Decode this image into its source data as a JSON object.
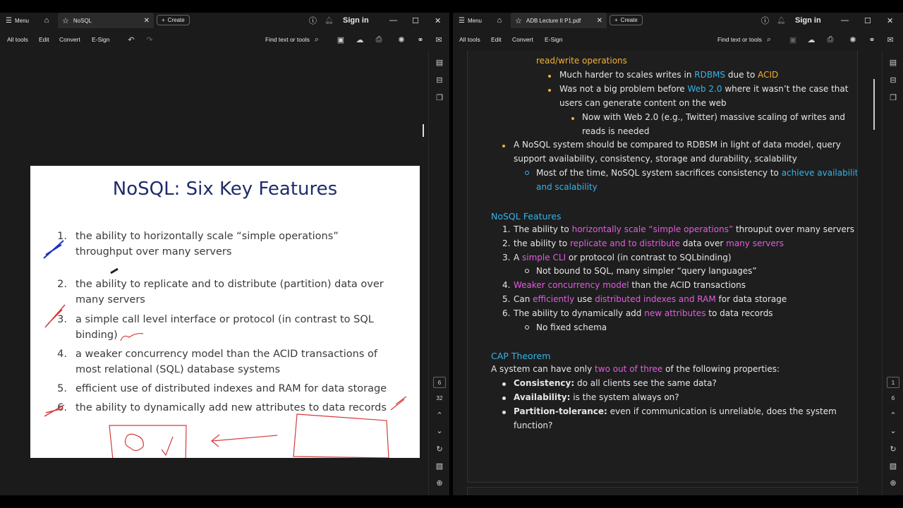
{
  "left_window": {
    "menu": "Menu",
    "tab_title": "NoSQL",
    "create": "Create",
    "sign_in": "Sign in",
    "toolbar": {
      "all_tools": "All tools",
      "edit": "Edit",
      "convert": "Convert",
      "esign": "E-Sign",
      "find": "Find text or tools"
    },
    "rail": {
      "page_current": "6",
      "page_total": "32"
    },
    "slide": {
      "title": "NoSQL: Six Key Features",
      "items": [
        {
          "num": "1.",
          "lines": [
            "the ability to horizontally scale “simple operations”",
            "throughput over many servers"
          ]
        },
        {
          "num": "2.",
          "lines": [
            "the ability to replicate and to distribute (partition) data over",
            "many servers"
          ]
        },
        {
          "num": "3.",
          "lines": [
            "a simple call level interface or protocol (in contrast to SQL",
            "binding)"
          ]
        },
        {
          "num": "4.",
          "lines": [
            "a weaker concurrency model than the ACID transactions of",
            "most relational (SQL) database systems"
          ]
        },
        {
          "num": "5.",
          "lines": [
            "efficient use of distributed indexes and RAM for data storage"
          ]
        },
        {
          "num": "6.",
          "lines": [
            "the ability to dynamically add new attributes to data records"
          ]
        }
      ]
    }
  },
  "right_window": {
    "menu": "Menu",
    "tab_title": "ADB Lecture II P1.pdf",
    "create": "Create",
    "sign_in": "Sign in",
    "toolbar": {
      "all_tools": "All tools",
      "edit": "Edit",
      "convert": "Convert",
      "esign": "E-Sign",
      "find": "Find text or tools"
    },
    "rail": {
      "page_current": "1",
      "page_total": "6"
    },
    "notes": {
      "l1a": "read/write operations",
      "l2a": "Much harder to scales writes in ",
      "l2b": "RDBMS",
      "l2c": " due to ",
      "l2d": "ACID",
      "l3a": "Was not a big problem before ",
      "l3b": "Web 2.0",
      "l3c": " where it wasn’t the case that",
      "l4": "users can generate content on the web",
      "l5": "Now with Web 2.0 (e.g., Twitter) massive scaling of writes and",
      "l6": "reads is needed",
      "l7": "A NoSQL system should be compared to RDBSM in light of data model, query",
      "l8": "support availability, consistency, storage and durability, scalability",
      "l9a": "Most of the time, NoSQL system sacrifices consistency to ",
      "l9b": "achieve availability",
      "l10": "and scalability",
      "features_heading": "NoSQL Features",
      "f1a": "The ability to ",
      "f1b": "horizontally scale “simple operations”",
      "f1c": " throuput over many servers",
      "f2a": "the ability to ",
      "f2b": "replicate and to distribute",
      "f2c": " data over ",
      "f2d": "many servers",
      "f3a": "A ",
      "f3b": "simple CLI",
      "f3c": " or protocol (in contrast to SQLbinding)",
      "f3sub": "Not bound to SQL, many simpler “query languages”",
      "f4a": "Weaker concurrency model",
      "f4b": " than the ACID transactions",
      "f5a": "Can ",
      "f5b": "efficiently",
      "f5c": " use ",
      "f5d": "distributed indexes and RAM",
      "f5e": " for data storage",
      "f6a": "The ability to dynamically add ",
      "f6b": "new attributes",
      "f6c": " to data records",
      "f6sub": "No fixed schema",
      "nums": [
        "1.",
        "2.",
        "3.",
        "4.",
        "5.",
        "6."
      ],
      "cap_heading": "CAP Theorem",
      "cap_a": "A system can have only ",
      "cap_b": "two out of three",
      "cap_c": " of the following properties:",
      "c1a": "Consistency:",
      "c1b": " do all clients see the same data?",
      "c2a": "Availability:",
      "c2b": " is the system always on?",
      "c3a": "Partition-tolerance:",
      "c3b": " even if communication is unreliable, does the system",
      "c3c": "function?"
    }
  },
  "colors": {
    "accent_blue": "#34b4ea",
    "accent_orange": "#f2b233",
    "accent_pink": "#e25ce0",
    "slide_title": "#1f2c6b",
    "ink_red": "#d43a3a",
    "ink_blue": "#1a2fc0"
  }
}
